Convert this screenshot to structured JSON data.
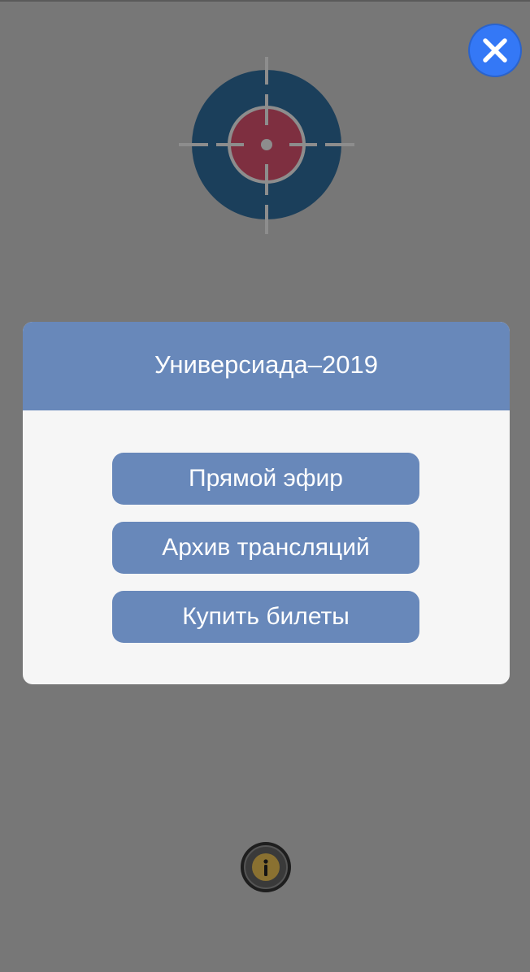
{
  "dialog": {
    "title": "Универсиада–2019",
    "buttons": [
      {
        "label": "Прямой эфир"
      },
      {
        "label": "Архив трансляций"
      },
      {
        "label": "Купить билеты"
      }
    ]
  },
  "icons": {
    "close": "close-icon",
    "target": "crosshair-target-icon",
    "info": "info-icon"
  },
  "colors": {
    "overlay": "#777777",
    "accent": "#6888ba",
    "close_button": "#3478f6",
    "target_outer": "#1b3f5b",
    "target_inner": "#7e2f40",
    "info_badge": "#8a7131"
  }
}
